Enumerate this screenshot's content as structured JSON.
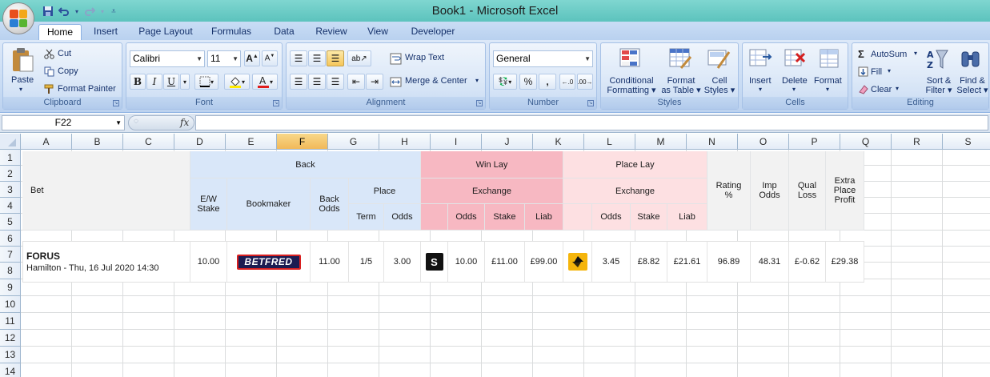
{
  "window": {
    "title": "Book1 - Microsoft Excel"
  },
  "ribbon_tabs": [
    "Home",
    "Insert",
    "Page Layout",
    "Formulas",
    "Data",
    "Review",
    "View",
    "Developer"
  ],
  "clipboard": {
    "paste": "Paste",
    "cut": "Cut",
    "copy": "Copy",
    "format_painter": "Format Painter",
    "label": "Clipboard"
  },
  "font": {
    "name": "Calibri",
    "size": "11",
    "label": "Font",
    "bold": "B",
    "italic": "I",
    "underline": "U"
  },
  "alignment": {
    "wrap_text": "Wrap Text",
    "merge_center": "Merge & Center",
    "label": "Alignment"
  },
  "number": {
    "format": "General",
    "label": "Number",
    "percent": "%",
    "comma": ","
  },
  "styles": {
    "conditional": [
      "Conditional",
      "Formatting"
    ],
    "format_table": [
      "Format",
      "as Table"
    ],
    "cell_styles": [
      "Cell",
      "Styles"
    ],
    "label": "Styles"
  },
  "cells": {
    "insert": "Insert",
    "delete": "Delete",
    "format": "Format",
    "label": "Cells"
  },
  "editing": {
    "autosum": "AutoSum",
    "fill": "Fill",
    "clear": "Clear",
    "sort_filter": [
      "Sort &",
      "Filter"
    ],
    "find_select": [
      "Find &",
      "Select"
    ],
    "label": "Editing"
  },
  "formula_bar": {
    "name_box": "F22",
    "fx": "fx",
    "value": ""
  },
  "columns": [
    "A",
    "B",
    "C",
    "D",
    "E",
    "F",
    "G",
    "H",
    "I",
    "J",
    "K",
    "L",
    "M",
    "N",
    "O",
    "P",
    "Q",
    "R",
    "S"
  ],
  "rows": [
    "1",
    "2",
    "3",
    "4",
    "5",
    "6",
    "7",
    "8",
    "9",
    "10",
    "11",
    "12",
    "13",
    "14"
  ],
  "selected_column": "F",
  "table_header": {
    "bet": "Bet",
    "back": "Back",
    "win_lay": "Win Lay",
    "place_lay": "Place Lay",
    "exchange": "Exchange",
    "ew_stake": [
      "E/W",
      "Stake"
    ],
    "bookmaker": "Bookmaker",
    "back_odds": [
      "Back",
      "Odds"
    ],
    "place": "Place",
    "term": "Term",
    "odds": "Odds",
    "stake": "Stake",
    "liab": "Liab",
    "rating": [
      "Rating",
      "%"
    ],
    "imp_odds": [
      "Imp",
      "Odds"
    ],
    "qual_loss": [
      "Qual",
      "Loss"
    ],
    "extra_place": [
      "Extra",
      "Place",
      "Profit"
    ]
  },
  "bet_row": {
    "horse": "FORUS",
    "race": "Hamilton - Thu, 16 Jul 2020 14:30",
    "ew_stake": "10.00",
    "bookmaker_logo": "BETFRED",
    "back_odds": "11.00",
    "term": "1/5",
    "place_odds": "3.00",
    "win_exchange_logo": "S",
    "win_odds": "10.00",
    "win_stake": "£11.00",
    "win_liab": "£99.00",
    "place_odds_lay": "3.45",
    "place_stake": "£8.82",
    "place_liab": "£21.61",
    "rating": "96.89",
    "imp_odds": "48.31",
    "qual_loss": "£-0.62",
    "extra_place": "£29.38"
  },
  "colors": {
    "back": "#d9e7f9",
    "win_lay": "#f7b8c2",
    "place_lay": "#fde0e2",
    "titlebar": "#6ccfc9"
  }
}
